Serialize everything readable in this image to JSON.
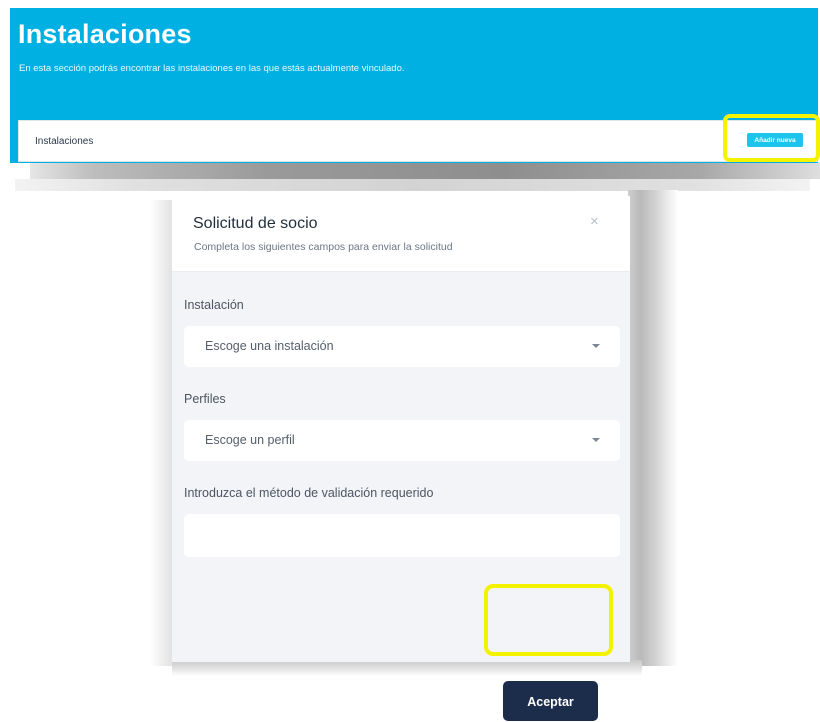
{
  "top_page": {
    "title": "Instalaciones",
    "description": "En esta sección podrás encontrar las instalaciones en las que estás actualmente vinculado.",
    "list_card_label": "Instalaciones",
    "add_new_button": "Añadir nueva"
  },
  "modal": {
    "title": "Solicitud de socio",
    "subtitle": "Completa los siguientes campos para enviar la solicitud",
    "close_symbol": "×",
    "fields": {
      "installation": {
        "label": "Instalación",
        "selected": "Escoge una instalación"
      },
      "profiles": {
        "label": "Perfiles",
        "selected": "Escoge un perfil"
      },
      "validation": {
        "label": "Introduzca el método de validación requerido",
        "value": ""
      }
    },
    "accept_button": "Aceptar"
  },
  "colors": {
    "header_bg": "#01b0e3",
    "add_button_bg": "#1ec3ee",
    "accept_button_bg": "#1b2d4a",
    "highlight": "#f5f200",
    "modal_body_bg": "#f3f4f7"
  },
  "icons": {
    "close": "close-icon",
    "dropdown": "chevron-down-icon"
  }
}
